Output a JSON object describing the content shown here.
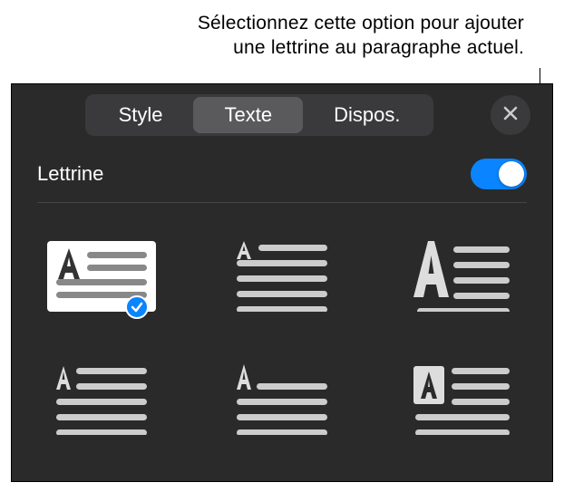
{
  "callout": {
    "line1": "Sélectionnez cette option pour ajouter",
    "line2": "une lettrine au paragraphe actuel."
  },
  "tabs": {
    "style": "Style",
    "texte": "Texte",
    "dispos": "Dispos."
  },
  "section": {
    "title": "Lettrine"
  },
  "options": {
    "o1": "dropcap-raised",
    "o2": "dropcap-margin-small",
    "o3": "dropcap-heavy-left",
    "o4": "dropcap-inline",
    "o5": "dropcap-center-flow",
    "o6": "dropcap-boxed"
  }
}
